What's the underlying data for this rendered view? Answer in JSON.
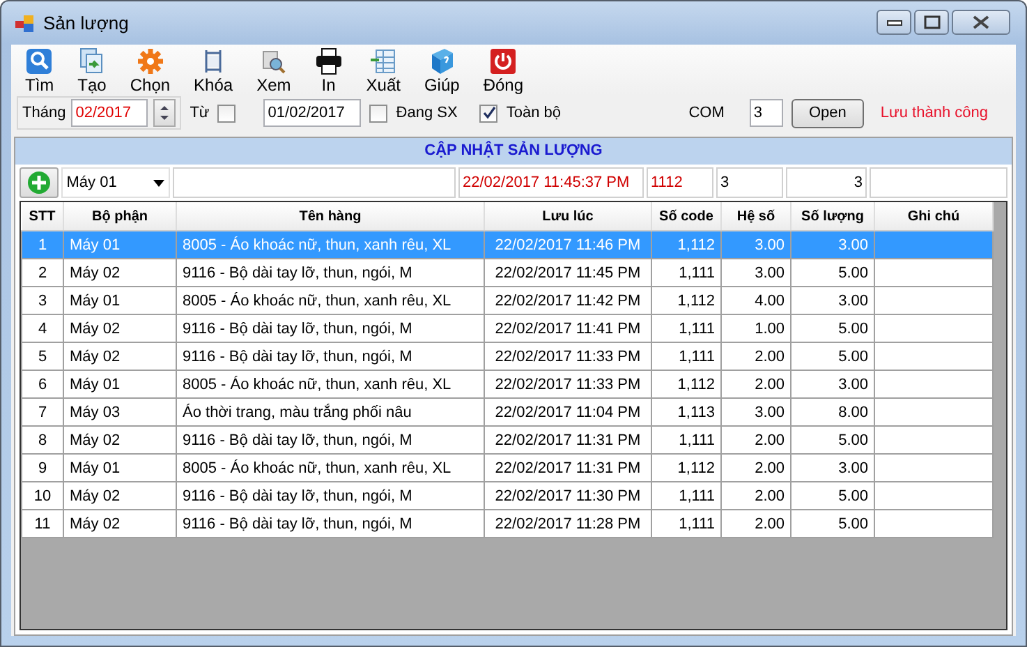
{
  "window": {
    "title": "Sản lượng"
  },
  "toolbar": [
    {
      "label": "Tìm",
      "kind": "search"
    },
    {
      "label": "Tạo",
      "kind": "new"
    },
    {
      "label": "Chọn",
      "kind": "gear"
    },
    {
      "label": "Khóa",
      "kind": "lock"
    },
    {
      "label": "Xem",
      "kind": "preview"
    },
    {
      "label": "In",
      "kind": "print"
    },
    {
      "label": "Xuất",
      "kind": "export"
    },
    {
      "label": "Giúp",
      "kind": "help"
    },
    {
      "label": "Đóng",
      "kind": "power"
    }
  ],
  "filter": {
    "month_label": "Tháng",
    "month": "02/2017",
    "from_label": "Từ",
    "from_checked": false,
    "date": "01/02/2017",
    "in_production": {
      "label": "Đang SX",
      "checked": false
    },
    "all": {
      "label": "Toàn bộ",
      "checked": true
    },
    "com_label": "COM",
    "com": "3",
    "open_button": "Open",
    "status": "Lưu thành công"
  },
  "panel": {
    "title": "CẬP NHẬT SẢN LƯỢNG",
    "entry": {
      "department": "Máy 01",
      "time": "22/02/2017 11:45:37 PM",
      "code": "1112",
      "factor": "3",
      "quantity": "3"
    }
  },
  "table": {
    "columns": [
      "STT",
      "Bộ phận",
      "Tên hàng",
      "Lưu lúc",
      "Số code",
      "Hệ số",
      "Số lượng",
      "Ghi chú"
    ],
    "rows": [
      {
        "cells": [
          "1",
          "Máy 01",
          "8005 - Áo khoác nữ, thun, xanh rêu, XL",
          "22/02/2017 11:46 PM",
          "1,112",
          "3.00",
          "3.00",
          ""
        ],
        "selected": true
      },
      {
        "cells": [
          "2",
          "Máy 02",
          "9116 - Bộ dài tay lỡ, thun, ngói, M",
          "22/02/2017 11:45 PM",
          "1,111",
          "3.00",
          "5.00",
          ""
        ],
        "selected": false
      },
      {
        "cells": [
          "3",
          "Máy 01",
          "8005 - Áo khoác nữ, thun, xanh rêu, XL",
          "22/02/2017 11:42 PM",
          "1,112",
          "4.00",
          "3.00",
          ""
        ],
        "selected": false
      },
      {
        "cells": [
          "4",
          "Máy 02",
          "9116 - Bộ dài tay lỡ, thun, ngói, M",
          "22/02/2017 11:41 PM",
          "1,111",
          "1.00",
          "5.00",
          ""
        ],
        "selected": false
      },
      {
        "cells": [
          "5",
          "Máy 02",
          "9116 - Bộ dài tay lỡ, thun, ngói, M",
          "22/02/2017 11:33 PM",
          "1,111",
          "2.00",
          "5.00",
          ""
        ],
        "selected": false
      },
      {
        "cells": [
          "6",
          "Máy 01",
          "8005 - Áo khoác nữ, thun, xanh rêu, XL",
          "22/02/2017 11:33 PM",
          "1,112",
          "2.00",
          "3.00",
          ""
        ],
        "selected": false
      },
      {
        "cells": [
          "7",
          "Máy 03",
          "Áo thời trang, màu trắng phối nâu",
          "22/02/2017 11:04 PM",
          "1,113",
          "3.00",
          "8.00",
          ""
        ],
        "selected": false
      },
      {
        "cells": [
          "8",
          "Máy 02",
          "9116 - Bộ dài tay lỡ, thun, ngói, M",
          "22/02/2017 11:31 PM",
          "1,111",
          "2.00",
          "5.00",
          ""
        ],
        "selected": false
      },
      {
        "cells": [
          "9",
          "Máy 01",
          "8005 - Áo khoác nữ, thun, xanh rêu, XL",
          "22/02/2017 11:31 PM",
          "1,112",
          "2.00",
          "3.00",
          ""
        ],
        "selected": false
      },
      {
        "cells": [
          "10",
          "Máy 02",
          "9116 - Bộ dài tay lỡ, thun, ngói, M",
          "22/02/2017 11:30 PM",
          "1,111",
          "2.00",
          "5.00",
          ""
        ],
        "selected": false
      },
      {
        "cells": [
          "11",
          "Máy 02",
          "9116 - Bộ dài tay lỡ, thun, ngói, M",
          "22/02/2017 11:28 PM",
          "1,111",
          "2.00",
          "5.00",
          ""
        ],
        "selected": false
      }
    ]
  }
}
